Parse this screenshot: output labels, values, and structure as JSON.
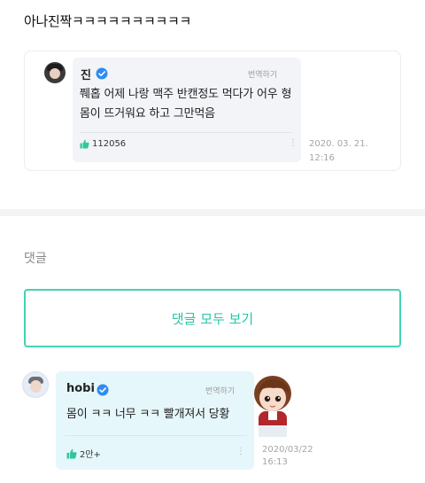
{
  "post": {
    "text": "아나진짝ㅋㅋㅋㅋㅋㅋㅋㅋㅋㅋ"
  },
  "quoted_comment": {
    "author": "진",
    "translate_label": "번역하기",
    "text": "쮀홉 어제 나랑 맥주 반캔정도 먹다가 어우 형 몸이 뜨거워요 하고 그만먹음",
    "likes": "112056",
    "date_line1": "2020. 03. 21.",
    "date_line2": "12:16"
  },
  "comments": {
    "title": "댓글",
    "view_all_label": "댓글 모두 보기",
    "items": [
      {
        "author": "hobi",
        "translate_label": "번역하기",
        "text": "몸이 ㅋㅋ 너무 ㅋㅋ 빨개져서 당황",
        "likes": "2만+",
        "date_line1": "2020/03/22",
        "date_line2": "16:13"
      }
    ]
  },
  "colors": {
    "accent": "#25c6a5",
    "verified": "#2f8cf2",
    "like": "#30c79a"
  },
  "icons": {
    "verified": "verified-badge-icon",
    "like": "thumbs-up-icon",
    "more": "more-vertical-icon"
  }
}
